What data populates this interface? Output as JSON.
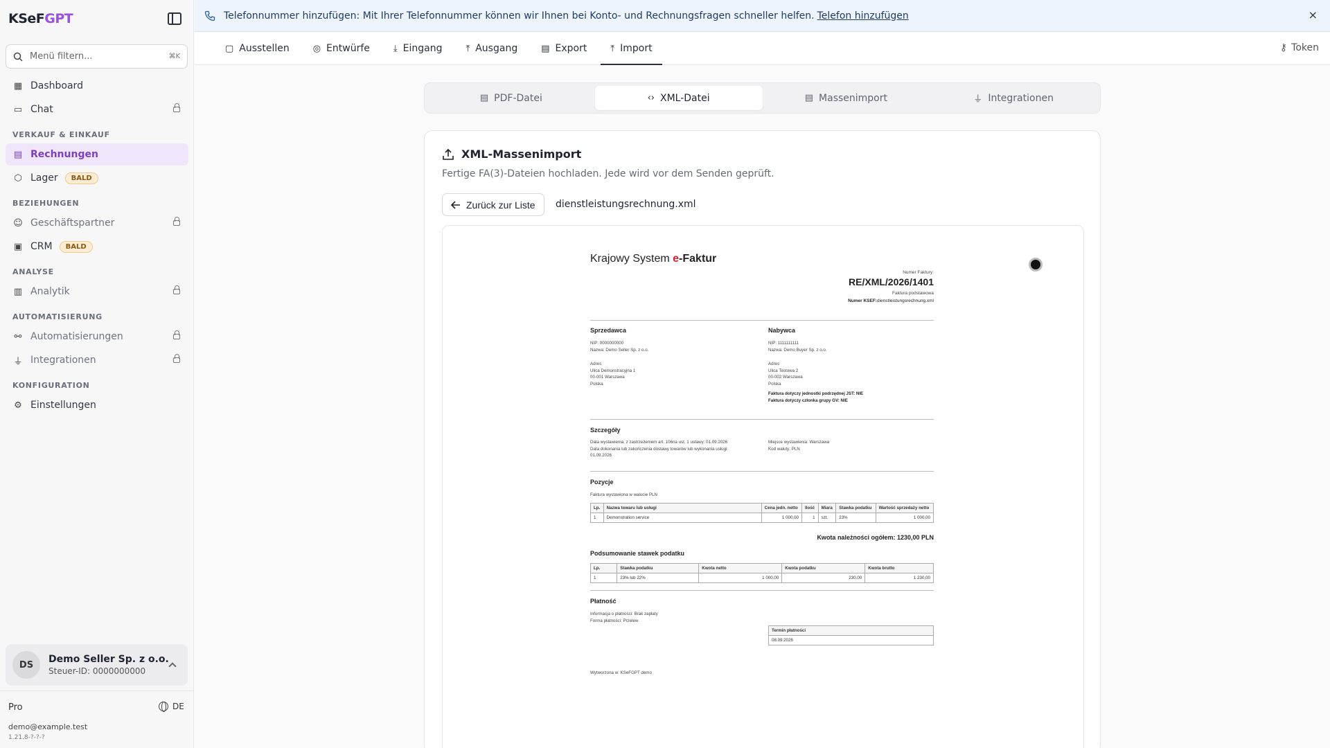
{
  "brand": {
    "prefix": "KSeF",
    "suffix": "GPT"
  },
  "sidebar": {
    "search_placeholder": "Menü filtern...",
    "search_shortcut": "⌘K",
    "top_items": [
      {
        "label": "Dashboard"
      },
      {
        "label": "Chat"
      }
    ],
    "sections": [
      {
        "title": "VERKAUF & EINKAUF",
        "items": [
          {
            "label": "Rechnungen"
          },
          {
            "label": "Lager",
            "badge": "BALD"
          }
        ]
      },
      {
        "title": "BEZIEHUNGEN",
        "items": [
          {
            "label": "Geschäftspartner"
          },
          {
            "label": "CRM",
            "badge": "BALD"
          }
        ]
      },
      {
        "title": "ANALYSE",
        "items": [
          {
            "label": "Analytik"
          }
        ]
      },
      {
        "title": "AUTOMATISIERUNG",
        "items": [
          {
            "label": "Automatisierungen"
          },
          {
            "label": "Integrationen"
          }
        ]
      },
      {
        "title": "KONFIGURATION",
        "items": [
          {
            "label": "Einstellungen"
          }
        ]
      }
    ],
    "account": {
      "initials": "DS",
      "name": "Demo Seller Sp. z o.o.",
      "tax_id": "Steuer-ID: 0000000000"
    },
    "plan": "Pro",
    "language": "DE",
    "email": "demo@example.test",
    "version": "1.21.8-?-?-?"
  },
  "banner": {
    "text": "Telefonnummer hinzufügen: Mit Ihrer Telefonnummer können wir Ihnen bei Konto- und Rechnungsfragen schneller helfen.",
    "link": "Telefon hinzufügen",
    "close": "×"
  },
  "tabs": [
    "Ausstellen",
    "Entwürfe",
    "Eingang",
    "Ausgang",
    "Export",
    "Import"
  ],
  "active_tab": "Import",
  "token_label": "Token",
  "subtabs": [
    "PDF-Datei",
    "XML-Datei",
    "Massenimport",
    "Integrationen"
  ],
  "active_subtab": "XML-Datei",
  "card": {
    "title": "XML-Massenimport",
    "subtitle": "Fertige FA(3)-Dateien hochladen. Jede wird vor dem Senden geprüft.",
    "back_label": "Zurück zur Liste",
    "filename": "dienstleistungsrechnung.xml"
  },
  "invoice": {
    "title_prefix": "Krajowy System ",
    "title_e": "e",
    "title_suffix": "-Faktur",
    "num_label": "Numer Faktury:",
    "number": "RE/XML/2026/1401",
    "type": "Faktura podstawowa",
    "ksef_label": "Numer KSEF:",
    "ksef_value": "dienstleistungsrechnung.xml",
    "seller": {
      "heading": "Sprzedawca",
      "nip": "NIP: 0000000000",
      "name": "Nazwa: Demo Seller Sp. z o.o.",
      "addr_label": "Adres",
      "addr1": "Ulica Demonstracyjna 1",
      "addr2": "00-001 Warszawa",
      "addr3": "Polska"
    },
    "buyer": {
      "heading": "Nabywca",
      "nip": "NIP: 1111111111",
      "name": "Nazwa: Demo Buyer Sp. z o.o.",
      "addr_label": "Adres",
      "addr1": "Ulica Testowa 2",
      "addr2": "00-002 Warszawa",
      "addr3": "Polska",
      "note1": "Faktura dotyczy jednostki podrzędnej JST: NIE",
      "note2": "Faktura dotyczy członka grupy GV: NIE"
    },
    "details": {
      "heading": "Szczegóły",
      "issue": "Data wystawienia, z zastrzeżeniem art. 106na ust. 1 ustawy: 01.09.2026",
      "delivery1": "Data dokonania lub zakończenia dostawy towarów lub wykonania usługi:",
      "delivery2": "01.09.2026",
      "place": "Miejsce wystawienia: Warszawa",
      "currency": "Kod waluty: PLN"
    },
    "items": {
      "heading": "Pozycje",
      "currency_note": "Faktura wystawiona w walucie PLN",
      "headers": [
        "Lp.",
        "Nazwa towaru lub usługi",
        "Cena jedn. netto",
        "Ilość",
        "Miara",
        "Stawka podatku",
        "Wartość sprzedaży netto"
      ],
      "rows": [
        [
          "1",
          "Demonstration service",
          "1 000,00",
          "1",
          "szt.",
          "23%",
          "1 000,00"
        ]
      ],
      "total": "Kwota należności ogółem: 1230,00 PLN"
    },
    "tax_summary": {
      "heading": "Podsumowanie stawek podatku",
      "headers": [
        "Lp.",
        "Stawka podatku",
        "Kwota netto",
        "Kwota podatku",
        "Kwota brutto"
      ],
      "rows": [
        [
          "1",
          "23% lub 22%",
          "1 000,00",
          "230,00",
          "1 230,00"
        ]
      ]
    },
    "payment": {
      "heading": "Płatność",
      "info": "Informacja o płatności: Brak zapłaty",
      "form": "Forma płatności: Przelew",
      "due_header": "Termin płatności",
      "due_value": "08.09.2026"
    },
    "footer": "Wytworzona w: KSeFGPT demo"
  }
}
